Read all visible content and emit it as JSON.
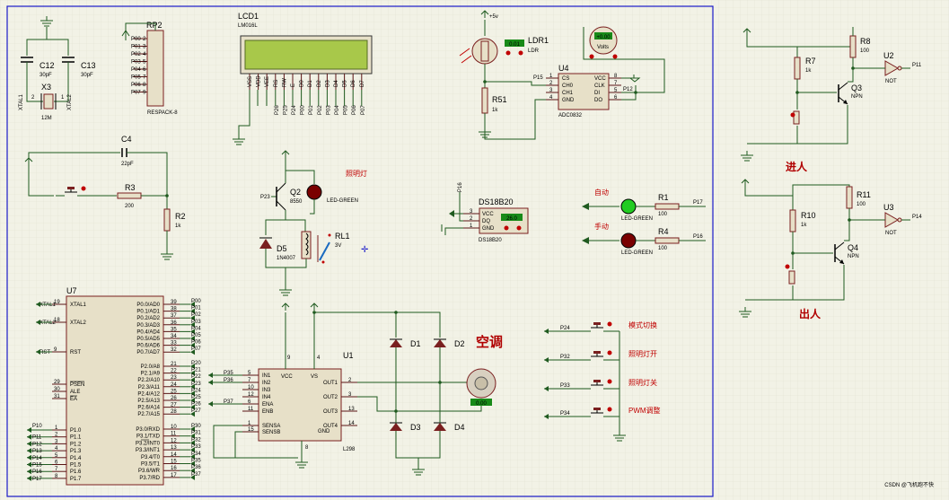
{
  "colors": {
    "grid": "#e3e3d3",
    "background": "#f2f2e6",
    "wire": "#1f5a1f",
    "body": "#e7e0c8",
    "outline": "#7a1f1f",
    "frame": "#1010c0",
    "lcd": "#a8c84a",
    "led_green": "#22cc22",
    "led_red": "#7a0000",
    "annotation": "#b00000"
  },
  "icons": [
    "ground-icon",
    "power-arrow-icon",
    "crystal-icon",
    "capacitor-icon",
    "resistor-icon",
    "led-icon",
    "diode-icon",
    "relay-icon",
    "motor-icon",
    "voltmeter-icon",
    "ldr-icon",
    "button-icon",
    "transistor-icon",
    "not-gate-icon"
  ],
  "components": {
    "rp2": {
      "ref": "RP2",
      "type": "RESPACK-8",
      "pins": [
        "P00",
        "P01",
        "P02",
        "P03",
        "P04",
        "P05",
        "P06",
        "P07"
      ]
    },
    "lcd1": {
      "ref": "LCD1",
      "type": "LM016L",
      "pins": [
        "VSS",
        "VDD",
        "VEE",
        "RS",
        "RW",
        "E",
        "D0",
        "D1",
        "D2",
        "D3",
        "D4",
        "D5",
        "D6",
        "D7"
      ],
      "port_labels": [
        "P26",
        "P25",
        "P24",
        "P00",
        "P01",
        "P02",
        "P03",
        "P04",
        "P05",
        "P06",
        "P07"
      ]
    },
    "c12": {
      "ref": "C12",
      "value": "30pF"
    },
    "c13": {
      "ref": "C13",
      "value": "30pF"
    },
    "x3": {
      "ref": "X3",
      "value": "12M",
      "net_left": "XTAL1",
      "net_right": "XTAL2"
    },
    "c4": {
      "ref": "C4",
      "value": "22pF"
    },
    "r3": {
      "ref": "R3",
      "value": "200"
    },
    "r2": {
      "ref": "R2",
      "value": "1k"
    },
    "ldr1": {
      "ref": "LDR1",
      "type": "LDR",
      "readout": "0.01",
      "supply": "+5v"
    },
    "voltmeter": {
      "label": "Volts",
      "readout": "+0.00"
    },
    "u4": {
      "ref": "U4",
      "type": "ADC0832",
      "left_pins": [
        "CS",
        "CH0",
        "CH1",
        "GND"
      ],
      "right_pins": [
        "VCC",
        "CLK",
        "DI",
        "DO"
      ],
      "left_nums": [
        "1",
        "2",
        "3",
        "4"
      ],
      "right_nums": [
        "8",
        "7",
        "5",
        "6"
      ],
      "net_cs": "P15",
      "net_clk": "P12"
    },
    "r51": {
      "ref": "R51",
      "value": "1k"
    },
    "q2": {
      "ref": "Q2",
      "type": "8550",
      "net": "P23"
    },
    "led_light": {
      "type": "LED-GREEN",
      "note": "照明灯"
    },
    "d5": {
      "ref": "D5",
      "type": "1N4007"
    },
    "rl1": {
      "ref": "RL1",
      "value": "3V"
    },
    "ds18b20": {
      "ref": "DS18B20",
      "type": "DS18B20",
      "pins": [
        "VCC",
        "DQ",
        "GND"
      ],
      "nums": [
        "3",
        "2",
        "1"
      ],
      "readout": "26.0",
      "net": "P16"
    },
    "led_auto": {
      "label": "自动",
      "type": "LED-GREEN"
    },
    "led_manual": {
      "label": "手动",
      "type": "LED-GREEN"
    },
    "r1": {
      "ref": "R1",
      "value": "100",
      "net": "P17"
    },
    "r4": {
      "ref": "R4",
      "value": "100",
      "net": "P16"
    },
    "u7": {
      "ref": "U7",
      "left_pins": [
        {
          "n": "19",
          "name": "XTAL1",
          "net": "XTAL1"
        },
        {
          "n": "18",
          "name": "XTAL2",
          "net": "XTAL2"
        },
        {
          "n": "9",
          "name": "RST",
          "net": "RST"
        },
        {
          "n": "29",
          "name": "PSEN",
          "net": ""
        },
        {
          "n": "30",
          "name": "ALE",
          "net": ""
        },
        {
          "n": "31",
          "name": "EA",
          "net": ""
        }
      ],
      "port1": {
        "net_header": "P10",
        "pins": [
          "P1.0",
          "P1.1",
          "P1.2",
          "P1.3",
          "P1.4",
          "P1.5",
          "P1.6",
          "P1.7"
        ],
        "nums": [
          "1",
          "2",
          "3",
          "4",
          "5",
          "6",
          "7",
          "8"
        ],
        "nets": [
          "",
          "P11",
          "P12",
          "P13",
          "P14",
          "P15",
          "P16",
          "P17"
        ]
      },
      "port0": {
        "pins": [
          "P0.0/AD0",
          "P0.1/AD1",
          "P0.2/AD2",
          "P0.3/AD3",
          "P0.4/AD4",
          "P0.5/AD5",
          "P0.6/AD6",
          "P0.7/AD7"
        ],
        "nums": [
          "39",
          "38",
          "37",
          "36",
          "35",
          "34",
          "33",
          "32"
        ],
        "nets": [
          "P00",
          "P01",
          "P02",
          "P03",
          "P04",
          "P05",
          "P06",
          "P07"
        ]
      },
      "port2": {
        "pins": [
          "P2.0/A8",
          "P2.1/A9",
          "P2.2/A10",
          "P2.3/A11",
          "P2.4/A12",
          "P2.5/A13",
          "P2.6/A14",
          "P2.7/A15"
        ],
        "nums": [
          "21",
          "22",
          "23",
          "24",
          "25",
          "26",
          "27",
          "28"
        ],
        "nets": [
          "P20",
          "P21",
          "P22",
          "P23",
          "P24",
          "P25",
          "P26",
          "P27"
        ]
      },
      "port3": {
        "pins": [
          "P3.0/RXD",
          "P3.1/TXD",
          "P3.2/INT0",
          "P3.3/INT1",
          "P3.4/T0",
          "P3.5/T1",
          "P3.6/WR",
          "P3.7/RD"
        ],
        "nums": [
          "10",
          "11",
          "12",
          "13",
          "14",
          "15",
          "16",
          "17"
        ],
        "nets": [
          "P30",
          "P31",
          "P32",
          "P33",
          "P34",
          "P35",
          "P36",
          "P37"
        ]
      }
    },
    "u1": {
      "ref": "U1",
      "type": "L298",
      "left_pins": [
        "IN1",
        "IN2",
        "IN3",
        "IN4",
        "ENA",
        "ENB"
      ],
      "left_nums": [
        "5",
        "7",
        "10",
        "12",
        "6",
        "11"
      ],
      "left_nets": [
        "P35",
        "P36",
        "",
        "",
        "P37",
        ""
      ],
      "sense_pins": [
        "SENSA",
        "SENSB"
      ],
      "sense_nums": [
        "1",
        "15"
      ],
      "top_pins": [
        "VCC",
        "VS"
      ],
      "top_nums": [
        "9",
        "4"
      ],
      "right_pins": [
        "OUT1",
        "OUT2",
        "OUT3",
        "OUT4"
      ],
      "right_nums": [
        "2",
        "3",
        "13",
        "14"
      ],
      "gnd": "GND",
      "gnd_num": "8"
    },
    "diodes": [
      "D1",
      "D2",
      "D3",
      "D4"
    ],
    "motor": {
      "label": "空调",
      "readout": "0.00"
    },
    "buttons": [
      {
        "net": "P24",
        "label": "模式切换"
      },
      {
        "net": "P32",
        "label": "照明灯开"
      },
      {
        "net": "P33",
        "label": "照明灯关"
      },
      {
        "net": "P34",
        "label": "PWM调整"
      }
    ],
    "r8": {
      "ref": "R8",
      "value": "100"
    },
    "r7": {
      "ref": "R7",
      "value": "1k"
    },
    "q3": {
      "ref": "Q3",
      "type": "NPN"
    },
    "u2": {
      "ref": "U2",
      "type": "NOT",
      "net": "P11"
    },
    "r11": {
      "ref": "R11",
      "value": "100"
    },
    "r10": {
      "ref": "R10",
      "value": "1k"
    },
    "q4": {
      "ref": "Q4",
      "type": "NPN"
    },
    "u3": {
      "ref": "U3",
      "type": "NOT",
      "net": "P14"
    }
  },
  "labels": {
    "enter": "进人",
    "exit": "出人"
  },
  "watermark": "CSDN @飞机跑不快"
}
